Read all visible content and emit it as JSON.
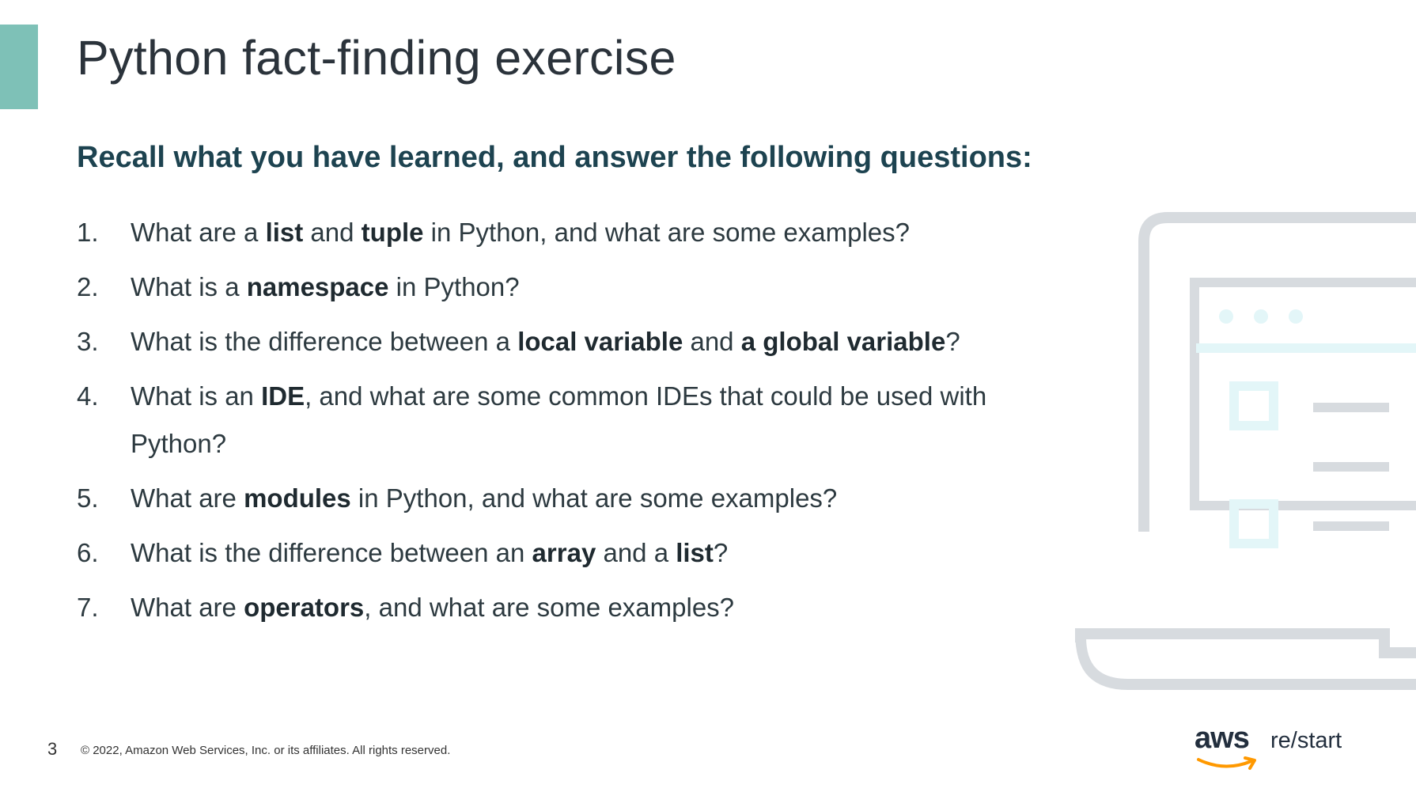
{
  "slide": {
    "title": "Python fact-finding exercise",
    "subtitle": "Recall what you have learned, and answer the following questions:",
    "questions": [
      {
        "number": "1.",
        "parts": [
          {
            "text": "What are a ",
            "bold": false
          },
          {
            "text": "list",
            "bold": true
          },
          {
            "text": " and ",
            "bold": false
          },
          {
            "text": "tuple",
            "bold": true
          },
          {
            "text": " in Python, and what are some examples?",
            "bold": false
          }
        ]
      },
      {
        "number": "2.",
        "parts": [
          {
            "text": "What is a ",
            "bold": false
          },
          {
            "text": "namespace",
            "bold": true
          },
          {
            "text": " in Python?",
            "bold": false
          }
        ]
      },
      {
        "number": "3.",
        "parts": [
          {
            "text": "What is the difference between a ",
            "bold": false
          },
          {
            "text": "local variable",
            "bold": true
          },
          {
            "text": " and ",
            "bold": false
          },
          {
            "text": "a global variable",
            "bold": true
          },
          {
            "text": "?",
            "bold": false
          }
        ]
      },
      {
        "number": "4.",
        "parts": [
          {
            "text": "What is an ",
            "bold": false
          },
          {
            "text": "IDE",
            "bold": true
          },
          {
            "text": ", and what are some common IDEs that could be used with Python?",
            "bold": false
          }
        ]
      },
      {
        "number": "5.",
        "parts": [
          {
            "text": "What are ",
            "bold": false
          },
          {
            "text": "modules",
            "bold": true
          },
          {
            "text": " in Python, and what are some examples?",
            "bold": false
          }
        ]
      },
      {
        "number": "6.",
        "parts": [
          {
            "text": "What is the difference between an ",
            "bold": false
          },
          {
            "text": "array",
            "bold": true
          },
          {
            "text": " and a ",
            "bold": false
          },
          {
            "text": "list",
            "bold": true
          },
          {
            "text": "?",
            "bold": false
          }
        ]
      },
      {
        "number": "7.",
        "parts": [
          {
            "text": "What are ",
            "bold": false
          },
          {
            "text": "operators",
            "bold": true
          },
          {
            "text": ", and what are some examples?",
            "bold": false
          }
        ]
      }
    ]
  },
  "footer": {
    "page_number": "3",
    "copyright": "© 2022, Amazon Web Services, Inc. or its affiliates. All rights reserved.",
    "logo_aws": "aws",
    "logo_product": "re/start"
  },
  "illustration": {
    "icon": "laptop-icon",
    "color": "#d7dbdf",
    "accent_color": "#e3f6f8"
  },
  "colors": {
    "accent_bar": "#7ec1b7",
    "subtitle": "#1d4350",
    "logo_smile": "#ff9900"
  }
}
